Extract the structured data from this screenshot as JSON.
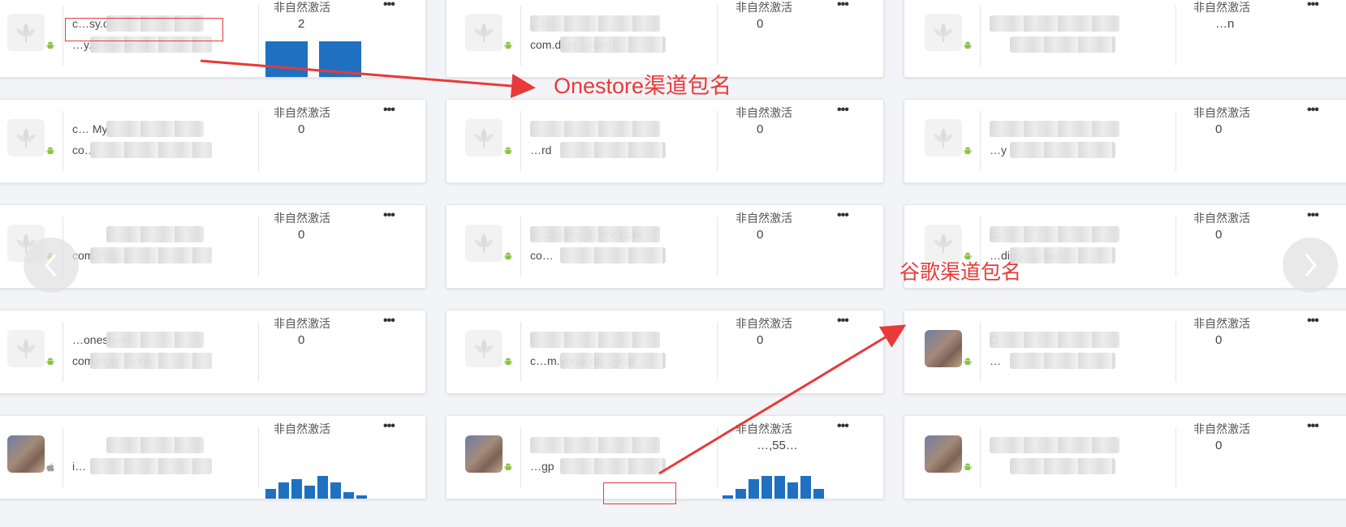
{
  "metric_label": "非自然激活",
  "more_label": "•••",
  "cards": [
    [
      {
        "name": "c…sy.one…",
        "pkg": "…y.one-onesto",
        "metric": "2",
        "icon": "placeholder-leaf",
        "chart": [
          2,
          2
        ]
      },
      {
        "name": "c… My…",
        "pkg": "co…",
        "metric": "0",
        "icon": "placeholder-leaf"
      },
      {
        "name": "",
        "pkg": "com.digg…",
        "metric": "0",
        "icon": "placeholder-leaf"
      },
      {
        "name": "…onestore",
        "pkg": "com.digg…-one",
        "metric": "0",
        "icon": "placeholder-leaf"
      },
      {
        "name": "",
        "pkg": "i…",
        "metric": "",
        "icon": "photo-avatar",
        "os": "apple",
        "chart": [
          3,
          5,
          6,
          4,
          7,
          5,
          2,
          1
        ]
      }
    ],
    [
      {
        "name": "…ta…",
        "pkg": "com.digg…ycard",
        "metric": "0",
        "icon": "placeholder-leaf"
      },
      {
        "name": "…",
        "pkg": "…rd",
        "metric": "0",
        "icon": "placeholder-leaf"
      },
      {
        "name": "c…digging.tk.onestore",
        "pkg": "co…",
        "metric": "0",
        "icon": "placeholder-leaf"
      },
      {
        "name": "c…",
        "pkg": "c…m.yunai.da…ycar",
        "metric": "0",
        "icon": "placeholder-leaf"
      },
      {
        "name": "",
        "pkg": "…gp",
        "metric": "…,55…",
        "icon": "photo-avatar",
        "chart": [
          1,
          3,
          6,
          7,
          7,
          5,
          7,
          3
        ]
      }
    ],
    [
      {
        "name": "",
        "pkg": "",
        "metric": "…n",
        "icon": "placeholder-leaf"
      },
      {
        "name": "",
        "pkg": "…y",
        "metric": "0",
        "icon": "placeholder-leaf"
      },
      {
        "name": "co…",
        "pkg": "…digg…ycard",
        "metric": "0",
        "icon": "placeholder-leaf"
      },
      {
        "name": "O…",
        "pkg": "…",
        "metric": "0",
        "icon": "photo-avatar"
      },
      {
        "name": "",
        "pkg": "",
        "metric": "0",
        "icon": "photo-avatar"
      }
    ]
  ],
  "annotations": {
    "onestore_label": "Onestore渠道包名",
    "google_label": "谷歌渠道包名",
    "color": "#e83a3a"
  },
  "nav": {
    "prev_icon": "chevron-left-icon",
    "next_icon": "chevron-right-icon"
  },
  "colors": {
    "bar": "#1f70c1",
    "android": "#8bc34a"
  }
}
